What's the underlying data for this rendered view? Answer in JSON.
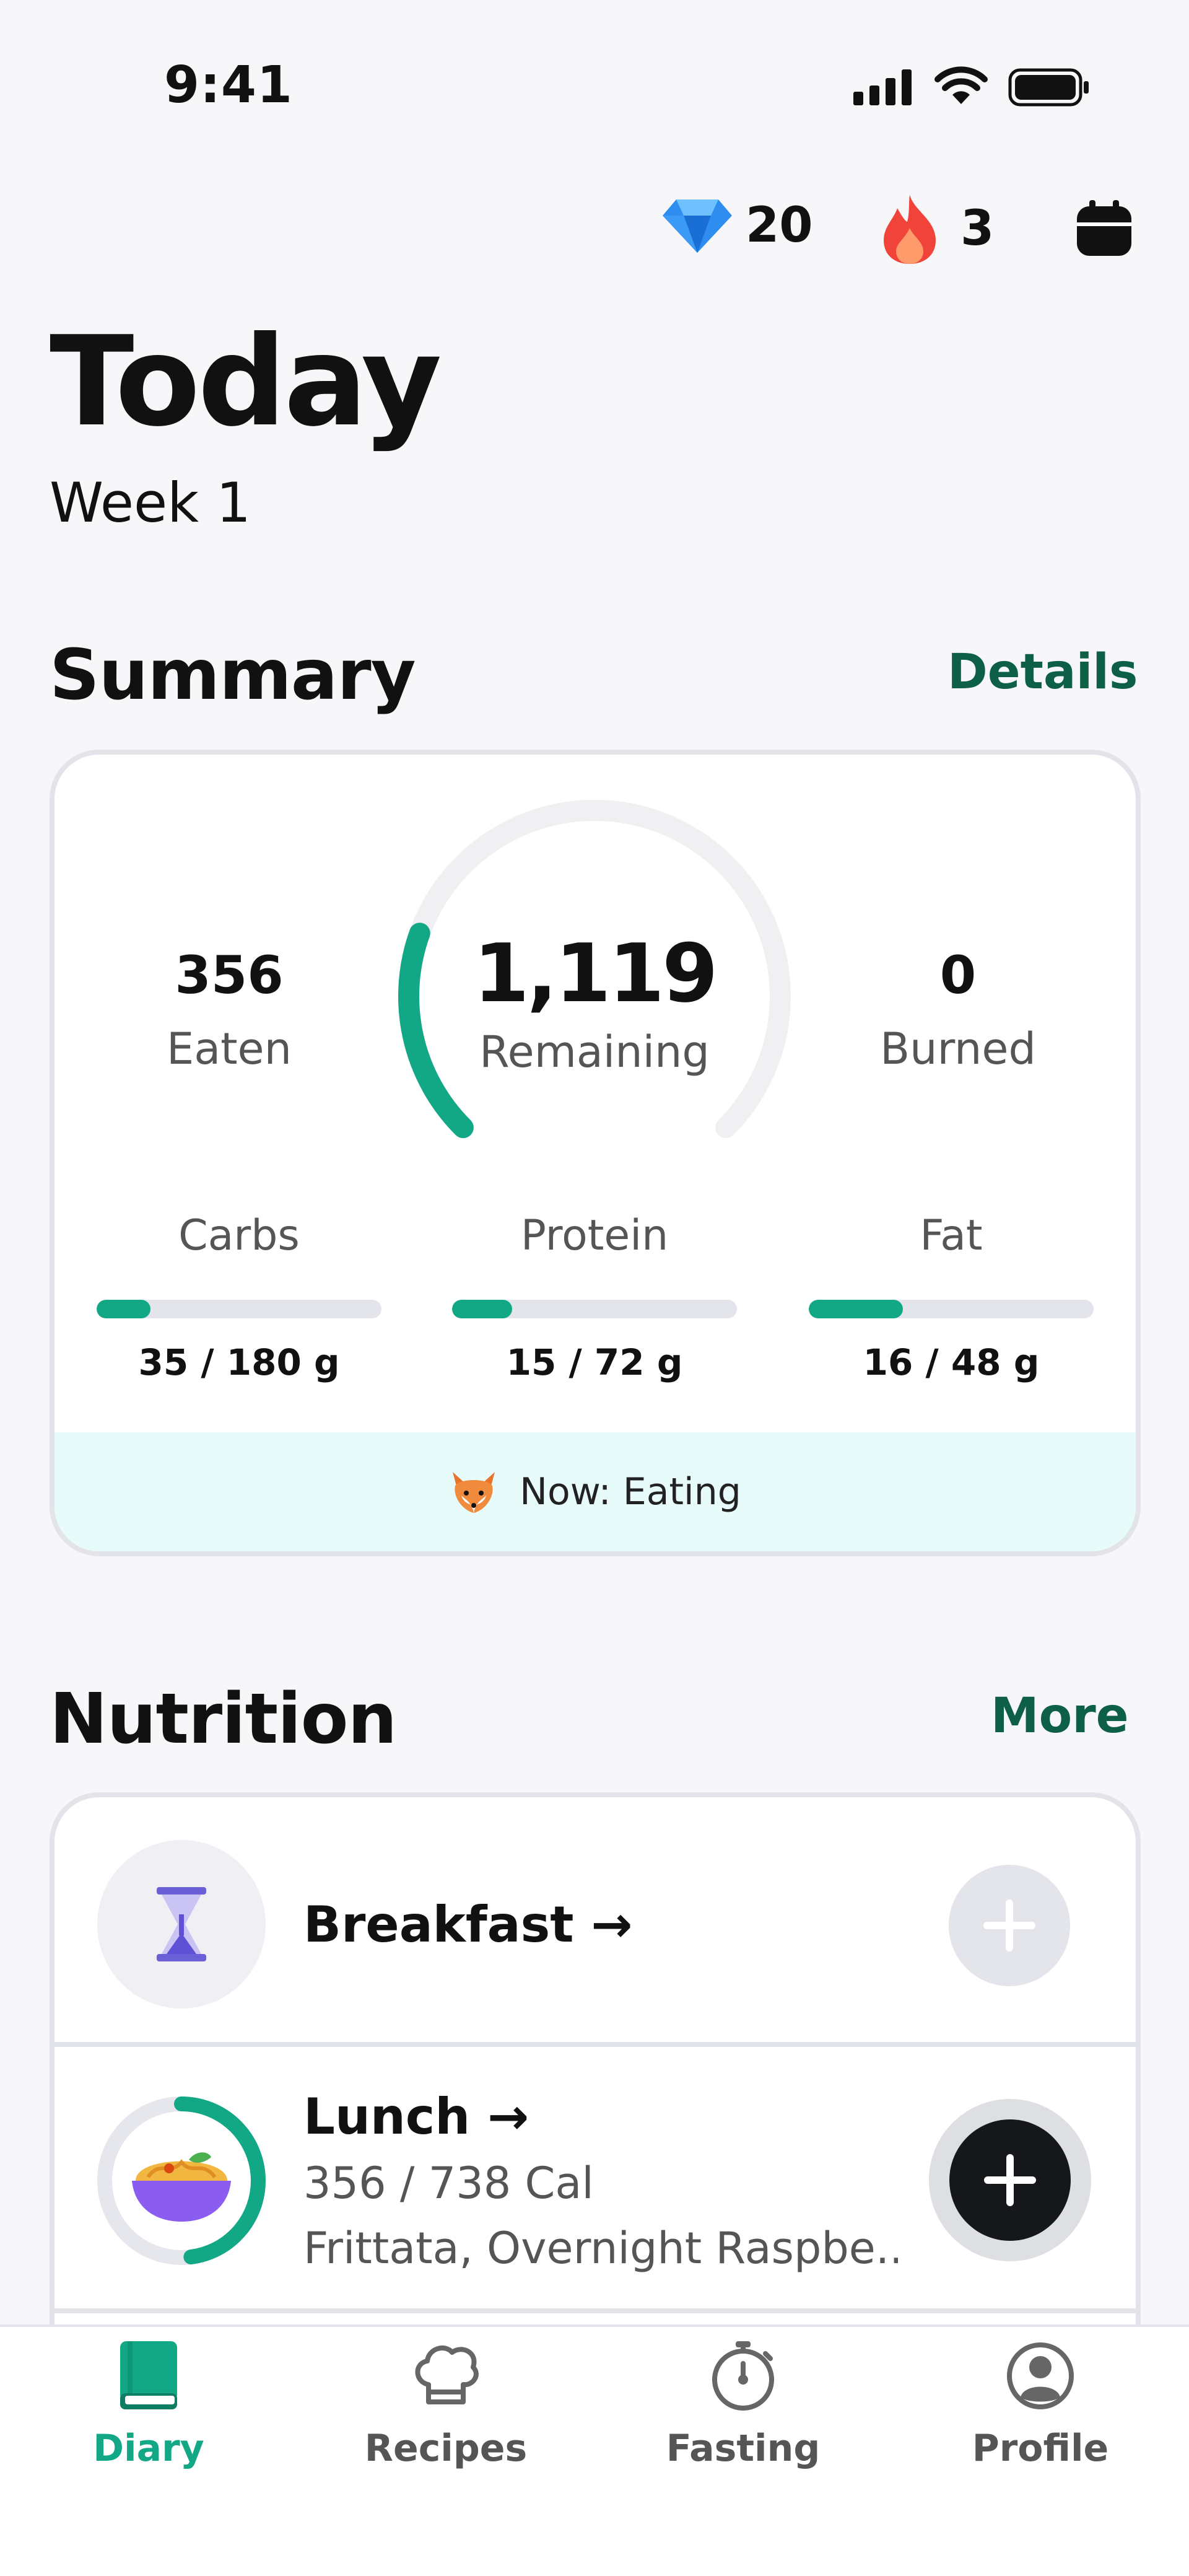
{
  "status_bar": {
    "time": "9:41"
  },
  "header": {
    "gems": "20",
    "streak": "3",
    "title": "Today",
    "subtitle": "Week 1"
  },
  "summary": {
    "heading": "Summary",
    "link": "Details",
    "eaten_value": "356",
    "eaten_label": "Eaten",
    "remaining_value": "1,119",
    "remaining_label": "Remaining",
    "burned_value": "0",
    "burned_label": "Burned",
    "gauge_progress": 0.24,
    "macros": [
      {
        "label": "Carbs",
        "value": "35 / 180 g",
        "progress": 0.19
      },
      {
        "label": "Protein",
        "value": "15 / 72 g",
        "progress": 0.21
      },
      {
        "label": "Fat",
        "value": "16 / 48 g",
        "progress": 0.33
      }
    ],
    "now_label": "Now: Eating"
  },
  "nutrition": {
    "heading": "Nutrition",
    "link": "More",
    "meals": [
      {
        "title": "Breakfast →"
      },
      {
        "title": "Lunch →",
        "calories": "356 / 738 Cal",
        "foods": "Frittata, Overnight Raspbe...",
        "progress": 0.48
      }
    ]
  },
  "tabs": [
    {
      "label": "Diary",
      "icon": "book-icon",
      "active": true
    },
    {
      "label": "Recipes",
      "icon": "chef-hat-icon",
      "active": false
    },
    {
      "label": "Fasting",
      "icon": "stopwatch-icon",
      "active": false
    },
    {
      "label": "Profile",
      "icon": "person-icon",
      "active": false
    }
  ],
  "colors": {
    "accent": "#12a886",
    "link": "#0d5f45",
    "background": "#f7f7fa"
  }
}
